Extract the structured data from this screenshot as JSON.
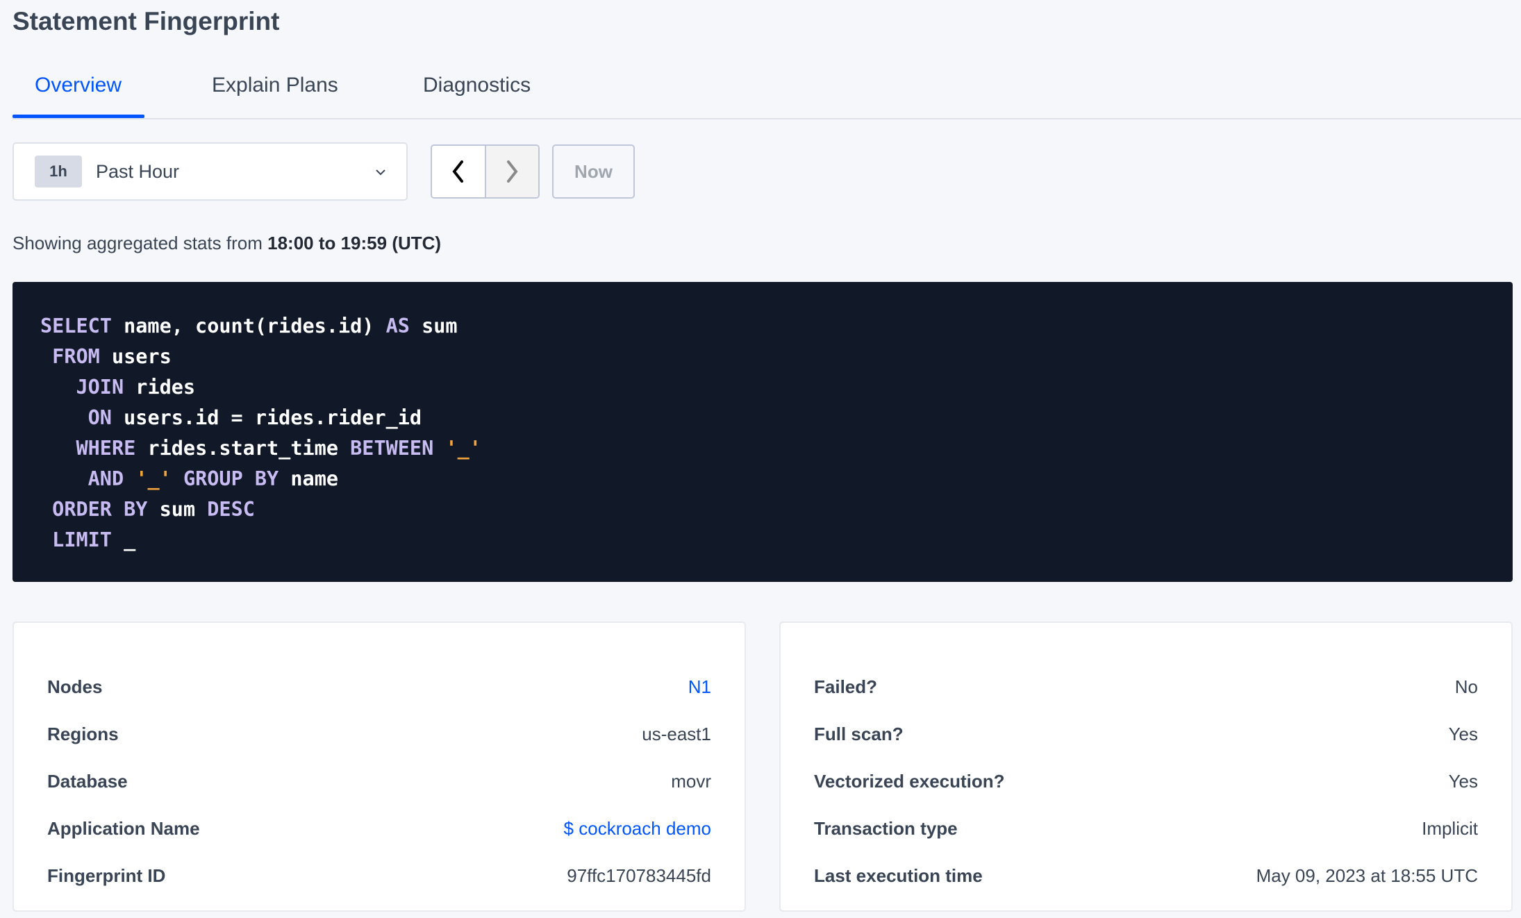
{
  "page": {
    "title": "Statement Fingerprint"
  },
  "tabs": [
    {
      "label": "Overview",
      "active": true
    },
    {
      "label": "Explain Plans",
      "active": false
    },
    {
      "label": "Diagnostics",
      "active": false
    }
  ],
  "time_picker": {
    "badge": "1h",
    "selected": "Past Hour",
    "prev_icon": "chevron-left-icon",
    "next_icon": "chevron-right-icon",
    "now_label": "Now"
  },
  "stats_range": {
    "prefix": "Showing aggregated stats from ",
    "range": "18:00 to 19:59 (UTC)"
  },
  "sql": {
    "lines": [
      [
        {
          "t": "SELECT",
          "k": 1
        },
        {
          "t": " name, count(rides.id) "
        },
        {
          "t": "AS",
          "k": 1
        },
        {
          "t": " sum"
        }
      ],
      [
        {
          "t": " "
        },
        {
          "t": "FROM",
          "k": 1
        },
        {
          "t": " users"
        }
      ],
      [
        {
          "t": "   "
        },
        {
          "t": "JOIN",
          "k": 1
        },
        {
          "t": " rides"
        }
      ],
      [
        {
          "t": "    "
        },
        {
          "t": "ON",
          "k": 1
        },
        {
          "t": " users.id = rides.rider_id"
        }
      ],
      [
        {
          "t": "   "
        },
        {
          "t": "WHERE",
          "k": 1
        },
        {
          "t": " rides.start_time "
        },
        {
          "t": "BETWEEN",
          "k": 1
        },
        {
          "t": " "
        },
        {
          "t": "'_'",
          "s": 1
        }
      ],
      [
        {
          "t": "    "
        },
        {
          "t": "AND",
          "k": 1
        },
        {
          "t": " "
        },
        {
          "t": "'_'",
          "s": 1
        },
        {
          "t": " "
        },
        {
          "t": "GROUP BY",
          "k": 1
        },
        {
          "t": " name"
        }
      ],
      [
        {
          "t": " "
        },
        {
          "t": "ORDER BY",
          "k": 1
        },
        {
          "t": " sum "
        },
        {
          "t": "DESC",
          "k": 1
        }
      ],
      [
        {
          "t": " "
        },
        {
          "t": "LIMIT",
          "k": 1
        },
        {
          "t": " _"
        }
      ]
    ],
    "colors": {
      "background": "#111827",
      "keyword": "#c7bbf2",
      "string": "#f0a43b",
      "text": "#ffffff"
    }
  },
  "left_card": [
    {
      "label": "Nodes",
      "value": "N1",
      "link": true
    },
    {
      "label": "Regions",
      "value": "us-east1"
    },
    {
      "label": "Database",
      "value": "movr"
    },
    {
      "label": "Application Name",
      "value": "$ cockroach demo",
      "link": true
    },
    {
      "label": "Fingerprint ID",
      "value": "97ffc170783445fd"
    }
  ],
  "right_card": [
    {
      "label": "Failed?",
      "value": "No"
    },
    {
      "label": "Full scan?",
      "value": "Yes"
    },
    {
      "label": "Vectorized execution?",
      "value": "Yes"
    },
    {
      "label": "Transaction type",
      "value": "Implicit"
    },
    {
      "label": "Last execution time",
      "value": "May 09, 2023 at 18:55 UTC"
    }
  ],
  "colors": {
    "accent": "#0055ff",
    "background": "#f5f7fa"
  }
}
